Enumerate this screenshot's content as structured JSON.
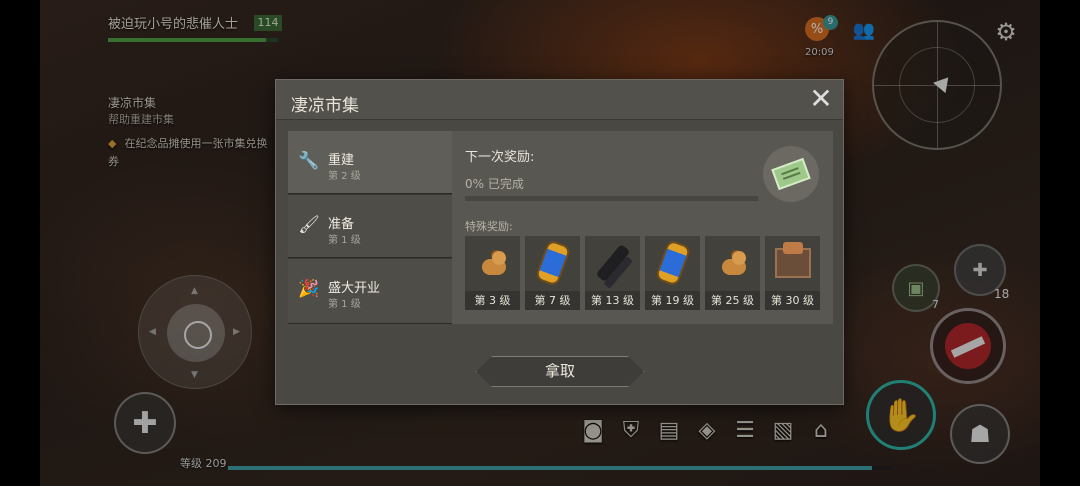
{
  "hud": {
    "player_name": "被迫玩小号的悲催人士",
    "player_health": "114",
    "health_fraction": 0.93,
    "quest": {
      "title": "凄凉市集",
      "subtitle": "帮助重建市集",
      "task": "在纪念品摊使用一张市集兑换券"
    },
    "promo_badge_count": "9",
    "clock": "20:09",
    "level_label": "等级 209",
    "xp_fraction": 0.97,
    "backpack_count": "7",
    "meds_count": "18",
    "accent_color": "#2fb8a8"
  },
  "dialog": {
    "title": "凄凉市集",
    "close_icon": "close-icon",
    "stages": [
      {
        "name": "重建",
        "level": "第 2 级",
        "icon": "wrench-icon"
      },
      {
        "name": "准备",
        "level": "第 1 级",
        "icon": "brush-icon"
      },
      {
        "name": "盛大开业",
        "level": "第 1 级",
        "icon": "party-popper-icon"
      }
    ],
    "active_stage": 0,
    "next_reward_label": "下一次奖励:",
    "progress_text": "0% 已完成",
    "progress_fraction": 0,
    "special_rewards_label": "特殊奖励:",
    "milestones": [
      {
        "label": "第 3 级",
        "icon": "dog-icon"
      },
      {
        "label": "第 7 级",
        "icon": "capsule-icon"
      },
      {
        "label": "第 13 级",
        "icon": "silencer-icon"
      },
      {
        "label": "第 19 级",
        "icon": "capsule-icon"
      },
      {
        "label": "第 25 级",
        "icon": "dog-icon"
      },
      {
        "label": "第 30 级",
        "icon": "crate-icon"
      }
    ],
    "collect_label": "拿取"
  }
}
